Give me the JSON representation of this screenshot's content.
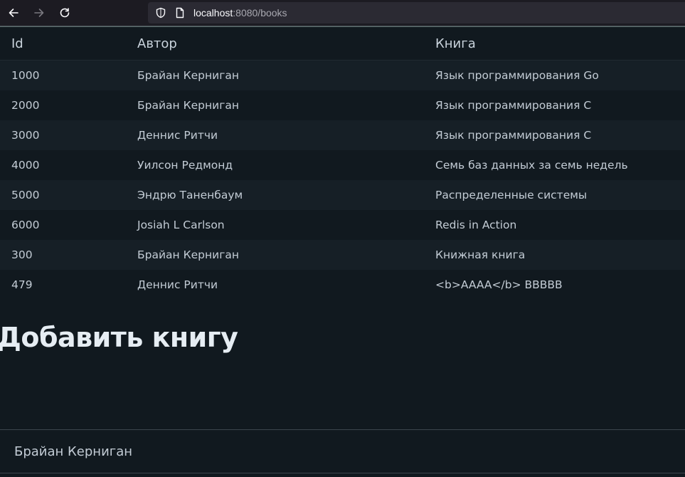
{
  "browser": {
    "url_host": "localhost",
    "url_rest": ":8080/books",
    "icons": {
      "back": "arrow-left-icon",
      "forward": "arrow-right-icon",
      "reload": "reload-icon",
      "shield": "shield-icon",
      "page": "page-icon"
    }
  },
  "table": {
    "headers": {
      "id": "Id",
      "author": "Автор",
      "book": "Книга"
    },
    "rows": [
      {
        "id": "1000",
        "author": "Брайан Керниган",
        "book": "Язык программирования Go"
      },
      {
        "id": "2000",
        "author": "Брайан Керниган",
        "book": "Язык программирования C"
      },
      {
        "id": "3000",
        "author": "Деннис Ритчи",
        "book": "Язык программирования C"
      },
      {
        "id": "4000",
        "author": "Уилсон Редмонд",
        "book": "Семь баз данных за семь недель"
      },
      {
        "id": "5000",
        "author": "Эндрю Таненбаум",
        "book": "Распределенные системы"
      },
      {
        "id": "6000",
        "author": "Josiah L Carlson",
        "book": "Redis in Action"
      },
      {
        "id": "300",
        "author": "Брайан Керниган",
        "book": "Книжная книга"
      },
      {
        "id": "479",
        "author": "Деннис Ритчи",
        "book": "<b>AAAA</b> BBBBB"
      }
    ]
  },
  "form": {
    "title": "Добавить книгу",
    "author_value": "Брайан Керниган"
  },
  "colors": {
    "background": "#11191f",
    "row_alt": "#161f26",
    "text": "#c3ccd5",
    "heading": "#e6edf3"
  }
}
